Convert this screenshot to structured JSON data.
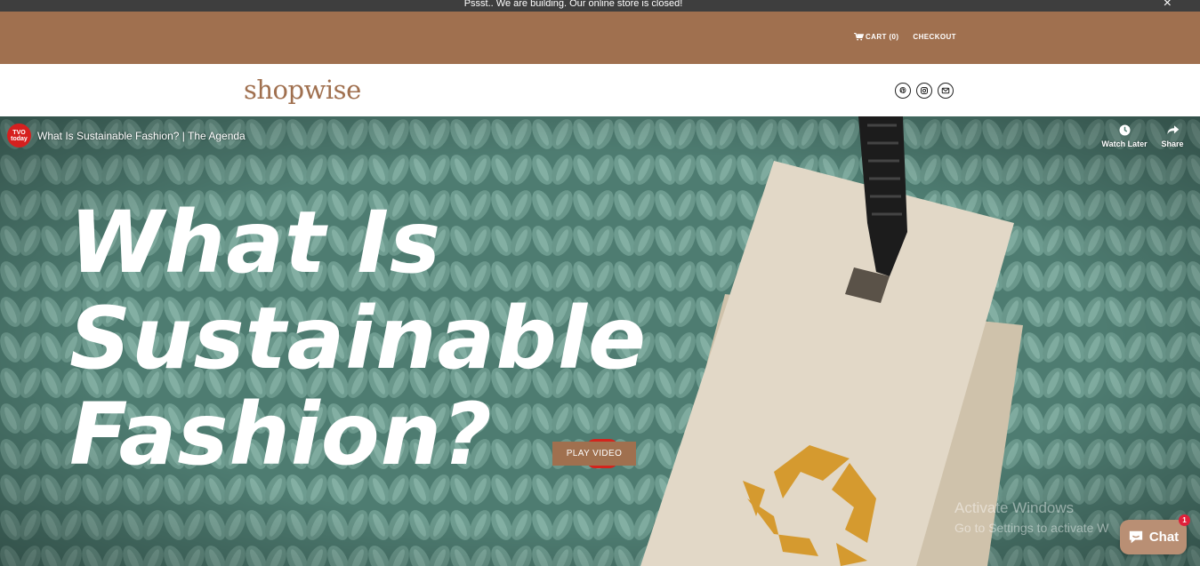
{
  "announcement": {
    "text": "Pssst.. We are building. Our online store is closed!",
    "close_glyph": "×"
  },
  "topbar": {
    "cart_label": "CART (0)",
    "checkout_label": "CHECKOUT",
    "background": "#a0704f"
  },
  "header": {
    "logo": "shopwise",
    "social_icons": [
      "pinterest-icon",
      "instagram-icon",
      "email-icon"
    ]
  },
  "video": {
    "channel_badge": {
      "line1": "TVO",
      "line2": "today"
    },
    "title": "What Is Sustainable Fashion? | The Agenda",
    "watch_later_label": "Watch Later",
    "share_label": "Share",
    "headline": {
      "line1": "What Is",
      "line2": "Sustainable",
      "line3": "Fashion?"
    },
    "play_label": "PLAY VIDEO"
  },
  "watermark": {
    "line1": "Activate Windows",
    "line2": "Go to Settings to activate W"
  },
  "chat": {
    "label": "Chat",
    "badge": "1"
  }
}
